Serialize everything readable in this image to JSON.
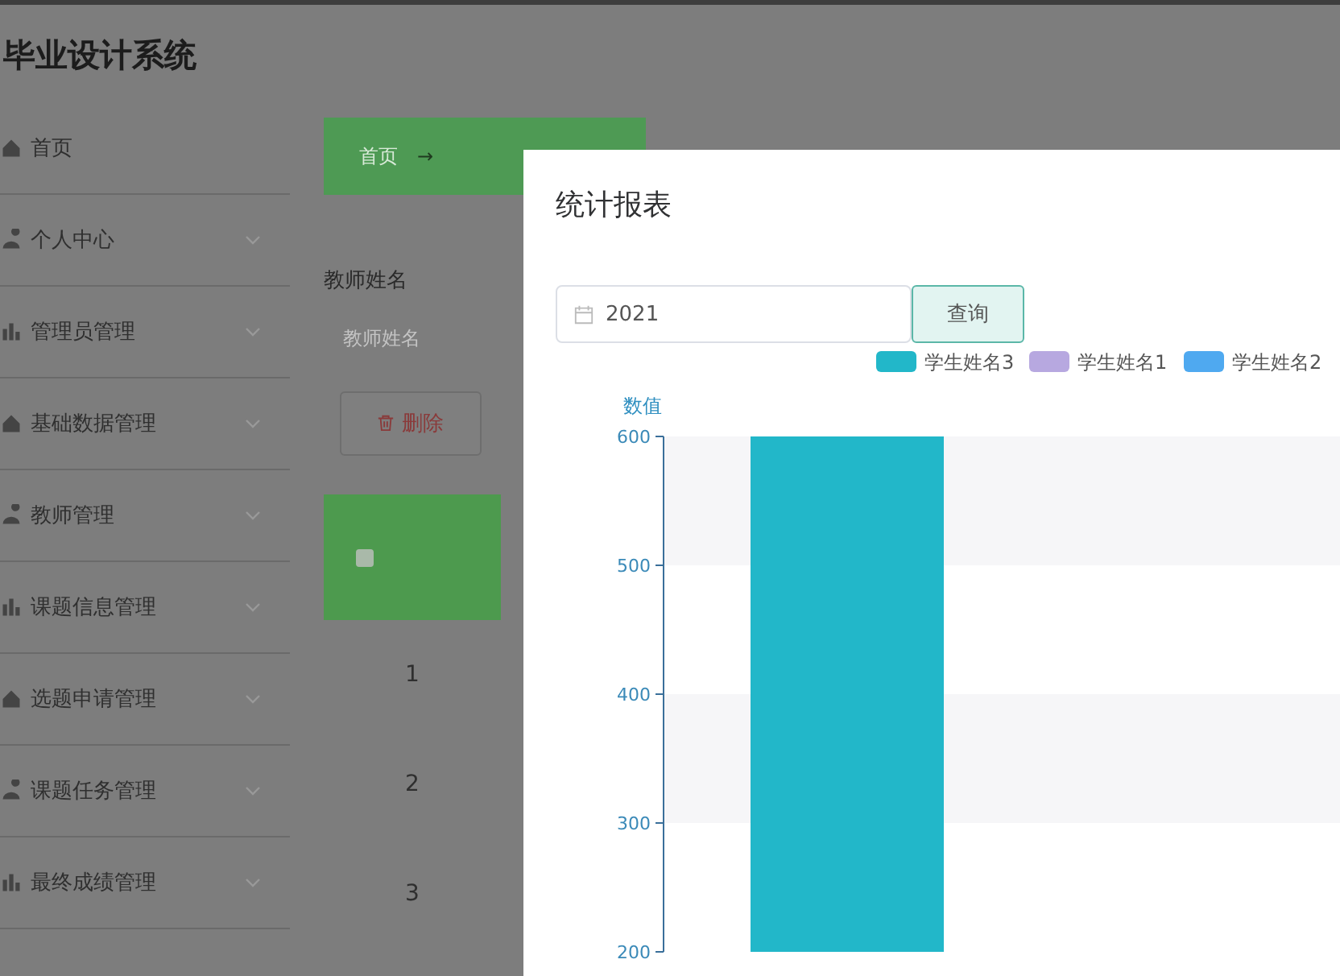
{
  "header": {
    "title": "毕业设计系统"
  },
  "sidebar": {
    "items": [
      {
        "label": "首页",
        "has_submenu": false
      },
      {
        "label": "个人中心",
        "has_submenu": true
      },
      {
        "label": "管理员管理",
        "has_submenu": true
      },
      {
        "label": "基础数据管理",
        "has_submenu": true
      },
      {
        "label": "教师管理",
        "has_submenu": true
      },
      {
        "label": "课题信息管理",
        "has_submenu": true
      },
      {
        "label": "选题申请管理",
        "has_submenu": true
      },
      {
        "label": "课题任务管理",
        "has_submenu": true
      },
      {
        "label": "最终成绩管理",
        "has_submenu": true
      }
    ]
  },
  "breadcrumb": {
    "items": [
      "首页"
    ],
    "separator": "→"
  },
  "search": {
    "label": "教师姓名",
    "placeholder": "教师姓名"
  },
  "toolbar": {
    "buttons": [
      {
        "label": "删除",
        "kind": "danger"
      }
    ]
  },
  "table": {
    "select_all": {
      "checked": false
    },
    "rows": [
      {
        "index": "1"
      },
      {
        "index": "2"
      },
      {
        "index": "3"
      }
    ]
  },
  "dialog": {
    "title": "统计报表",
    "date_field": {
      "value": "2021"
    },
    "query_button": "查询",
    "chart_data": {
      "type": "bar",
      "ylabel": "数值",
      "ylim": [
        200,
        600
      ],
      "yticks": [
        200,
        300,
        400,
        500,
        600
      ],
      "series": [
        {
          "name": "学生姓名3",
          "color": "#22b7c9",
          "values": [
            600
          ]
        },
        {
          "name": "学生姓名1",
          "color": "#b7a8e0",
          "values": [
            null
          ]
        },
        {
          "name": "学生姓名2",
          "color": "#4fa9f0",
          "values": [
            null
          ]
        }
      ]
    }
  }
}
